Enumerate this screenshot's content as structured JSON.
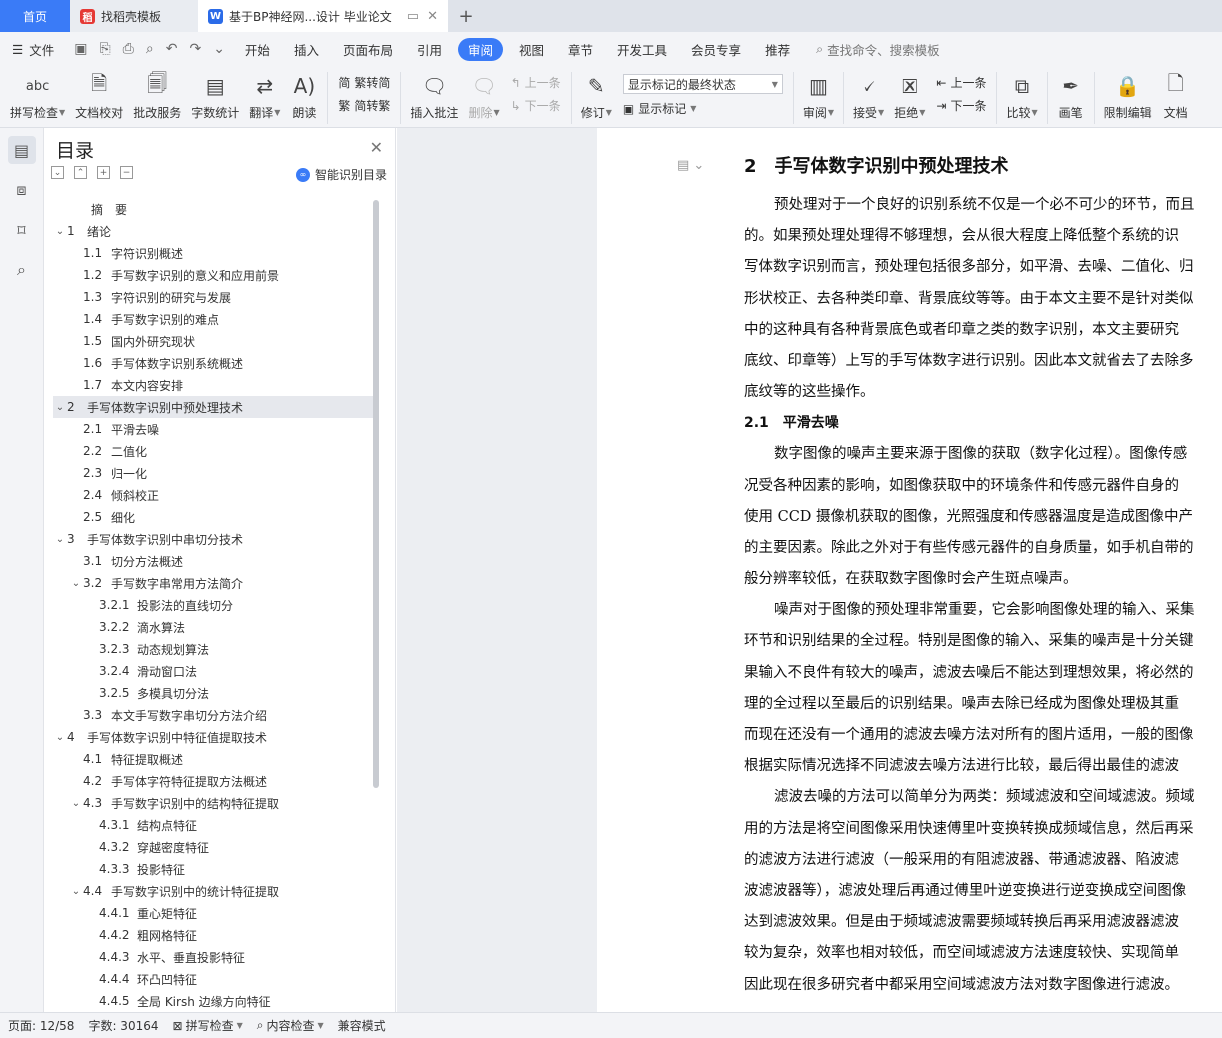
{
  "tabs": {
    "home": "首页",
    "t2": "找稻壳模板",
    "t3": "基于BP神经网...设计 毕业论文"
  },
  "menu": {
    "file": "文件",
    "items": [
      "开始",
      "插入",
      "页面布局",
      "引用",
      "审阅",
      "视图",
      "章节",
      "开发工具",
      "会员专享",
      "推荐"
    ],
    "active": "审阅",
    "search": "查找命令、搜索模板"
  },
  "ribbon": {
    "spell": "拼写检查",
    "proof": "文档校对",
    "batch": "批改服务",
    "wordcount": "字数统计",
    "translate": "翻译",
    "read": "朗读",
    "trad": "繁转简",
    "simp": "简转繁",
    "insert_comment": "插入批注",
    "delete": "删除",
    "prev": "上一条",
    "next": "下一条",
    "revise": "修订",
    "display_state": "显示标记的最终状态",
    "show_marks": "显示标记",
    "review": "审阅",
    "accept": "接受",
    "reject": "拒绝",
    "prev2": "上一条",
    "next2": "下一条",
    "compare": "比较",
    "pen": "画笔",
    "restrict": "限制编辑",
    "doc": "文档"
  },
  "toc": {
    "title": "目录",
    "smart": "智能识别目录",
    "items": [
      {
        "n": "",
        "t": "摘　要",
        "lvl": 1,
        "tw": ""
      },
      {
        "n": "1",
        "t": "绪论",
        "lvl": 1,
        "tw": "v"
      },
      {
        "n": "1.1",
        "t": "字符识别概述",
        "lvl": 2,
        "tw": ""
      },
      {
        "n": "1.2",
        "t": "手写数字识别的意义和应用前景",
        "lvl": 2,
        "tw": ""
      },
      {
        "n": "1.3",
        "t": "字符识别的研究与发展",
        "lvl": 2,
        "tw": ""
      },
      {
        "n": "1.4",
        "t": "手写数字识别的难点",
        "lvl": 2,
        "tw": ""
      },
      {
        "n": "1.5",
        "t": "国内外研究现状",
        "lvl": 2,
        "tw": ""
      },
      {
        "n": "1.6",
        "t": "手写体数字识别系统概述",
        "lvl": 2,
        "tw": ""
      },
      {
        "n": "1.7",
        "t": "本文内容安排",
        "lvl": 2,
        "tw": ""
      },
      {
        "n": "2",
        "t": "手写体数字识别中预处理技术",
        "lvl": 1,
        "tw": "v",
        "sel": true
      },
      {
        "n": "2.1",
        "t": "平滑去噪",
        "lvl": 2,
        "tw": ""
      },
      {
        "n": "2.2",
        "t": "二值化",
        "lvl": 2,
        "tw": ""
      },
      {
        "n": "2.3",
        "t": "归一化",
        "lvl": 2,
        "tw": ""
      },
      {
        "n": "2.4",
        "t": "倾斜校正",
        "lvl": 2,
        "tw": ""
      },
      {
        "n": "2.5",
        "t": "细化",
        "lvl": 2,
        "tw": ""
      },
      {
        "n": "3",
        "t": "手写体数字识别中串切分技术",
        "lvl": 1,
        "tw": "v"
      },
      {
        "n": "3.1",
        "t": "切分方法概述",
        "lvl": 2,
        "tw": ""
      },
      {
        "n": "3.2",
        "t": "手写数字串常用方法简介",
        "lvl": 2,
        "tw": "v"
      },
      {
        "n": "3.2.1",
        "t": "投影法的直线切分",
        "lvl": 3,
        "tw": ""
      },
      {
        "n": "3.2.2",
        "t": "滴水算法",
        "lvl": 3,
        "tw": ""
      },
      {
        "n": "3.2.3",
        "t": "动态规划算法",
        "lvl": 3,
        "tw": ""
      },
      {
        "n": "3.2.4",
        "t": "滑动窗口法",
        "lvl": 3,
        "tw": ""
      },
      {
        "n": "3.2.5",
        "t": "多模具切分法",
        "lvl": 3,
        "tw": ""
      },
      {
        "n": "3.3",
        "t": "本文手写数字串切分方法介绍",
        "lvl": 2,
        "tw": ""
      },
      {
        "n": "4",
        "t": "手写体数字识别中特征值提取技术",
        "lvl": 1,
        "tw": "v"
      },
      {
        "n": "4.1",
        "t": "特征提取概述",
        "lvl": 2,
        "tw": ""
      },
      {
        "n": "4.2",
        "t": "手写体字符特征提取方法概述",
        "lvl": 2,
        "tw": ""
      },
      {
        "n": "4.3",
        "t": "手写数字识别中的结构特征提取",
        "lvl": 2,
        "tw": "v"
      },
      {
        "n": "4.3.1",
        "t": "结构点特征",
        "lvl": 3,
        "tw": ""
      },
      {
        "n": "4.3.2",
        "t": "穿越密度特征",
        "lvl": 3,
        "tw": ""
      },
      {
        "n": "4.3.3",
        "t": "投影特征",
        "lvl": 3,
        "tw": ""
      },
      {
        "n": "4.4",
        "t": "手写数字识别中的统计特征提取",
        "lvl": 2,
        "tw": "v"
      },
      {
        "n": "4.4.1",
        "t": "重心矩特征",
        "lvl": 3,
        "tw": ""
      },
      {
        "n": "4.4.2",
        "t": "粗网格特征",
        "lvl": 3,
        "tw": ""
      },
      {
        "n": "4.4.3",
        "t": "水平、垂直投影特征",
        "lvl": 3,
        "tw": ""
      },
      {
        "n": "4.4.4",
        "t": "环凸凹特征",
        "lvl": 3,
        "tw": ""
      },
      {
        "n": "4.4.5",
        "t": "全局 Kirsh 边缘方向特征",
        "lvl": 3,
        "tw": ""
      }
    ]
  },
  "doc": {
    "h2": "2　手写体数字识别中预处理技术",
    "p1": [
      "预处理对于一个良好的识别系统不仅是一个必不可少的环节，而且",
      "的。如果预处理处理得不够理想，会从很大程度上降低整个系统的识",
      "写体数字识别而言，预处理包括很多部分，如平滑、去噪、二值化、归",
      "形状校正、去各种类印章、背景底纹等等。由于本文主要不是针对类似",
      "中的这种具有各种背景底色或者印章之类的数字识别，本文主要研究",
      "底纹、印章等）上写的手写体数字进行识别。因此本文就省去了去除多",
      "底纹等的这些操作。"
    ],
    "h3": "2.1　平滑去噪",
    "p2": [
      "数字图像的噪声主要来源于图像的获取（数字化过程）。图像传感",
      "况受各种因素的影响，如图像获取中的环境条件和传感元器件自身的",
      "使用 CCD 摄像机获取的图像，光照强度和传感器温度是造成图像中产",
      "的主要因素。除此之外对于有些传感元器件的自身质量，如手机自带的",
      "般分辨率较低，在获取数字图像时会产生斑点噪声。"
    ],
    "p3": [
      "噪声对于图像的预处理非常重要，它会影响图像处理的输入、采集",
      "环节和识别结果的全过程。特别是图像的输入、采集的噪声是十分关键",
      "果输入不良件有较大的噪声，滤波去噪后不能达到理想效果，将必然的",
      "理的全过程以至最后的识别结果。噪声去除已经成为图像处理极其重",
      "而现在还没有一个通用的滤波去噪方法对所有的图片适用，一般的图像",
      "根据实际情况选择不同滤波去噪方法进行比较，最后得出最佳的滤波"
    ],
    "p4": [
      "滤波去噪的方法可以简单分为两类：频域滤波和空间域滤波。频域",
      "用的方法是将空间图像采用快速傅里叶变换转换成频域信息，然后再采",
      "的滤波方法进行滤波（一般采用的有阻滤波器、带通滤波器、陷波滤",
      "波滤波器等），滤波处理后再通过傅里叶逆变换进行逆变换成空间图像",
      "达到滤波效果。但是由于频域滤波需要频域转换后再采用滤波器滤波",
      "较为复杂，效率也相对较低，而空间域滤波方法速度较快、实现简单",
      "因此现在很多研究者中都采用空间域滤波方法对数字图像进行滤波。"
    ]
  },
  "status": {
    "page": "页面: 12/58",
    "words": "字数: 30164",
    "spell": "拼写检查",
    "content": "内容检查",
    "compat": "兼容模式"
  }
}
